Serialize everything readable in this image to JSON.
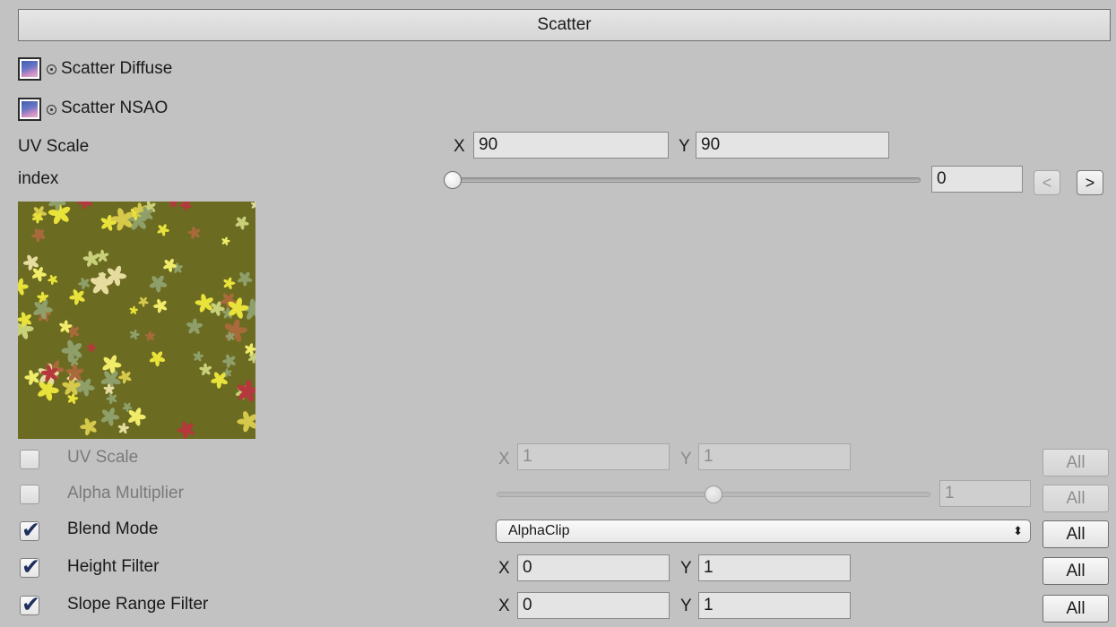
{
  "header": {
    "title": "Scatter"
  },
  "textures": [
    {
      "label": "Scatter Diffuse"
    },
    {
      "label": "Scatter NSAO"
    }
  ],
  "uv_scale": {
    "label": "UV Scale",
    "x_label": "X",
    "x_value": "90",
    "y_label": "Y",
    "y_value": "90"
  },
  "index": {
    "label": "index",
    "value": "0",
    "slider_fraction": 0.0,
    "prev_label": "<",
    "next_label": ">"
  },
  "layer_rows": [
    {
      "label": "UV Scale",
      "checked": false,
      "x_label": "X",
      "x_value": "1",
      "y_label": "Y",
      "y_value": "1",
      "all_label": "All"
    },
    {
      "label": "Alpha Multiplier",
      "checked": false,
      "value": "1",
      "slider_fraction": 0.5,
      "all_label": "All"
    },
    {
      "label": "Blend Mode",
      "checked": true,
      "value": "AlphaClip",
      "all_label": "All"
    },
    {
      "label": "Height Filter",
      "checked": true,
      "x_label": "X",
      "x_value": "0",
      "y_label": "Y",
      "y_value": "1",
      "all_label": "All"
    },
    {
      "label": "Slope Range Filter",
      "checked": true,
      "x_label": "X",
      "x_value": "0",
      "y_label": "Y",
      "y_value": "1",
      "all_label": "All"
    }
  ],
  "colors": {
    "panel_bg": "#c2c2c2",
    "preview_bg": "#6b6b22",
    "checkmark": "#20305e"
  }
}
